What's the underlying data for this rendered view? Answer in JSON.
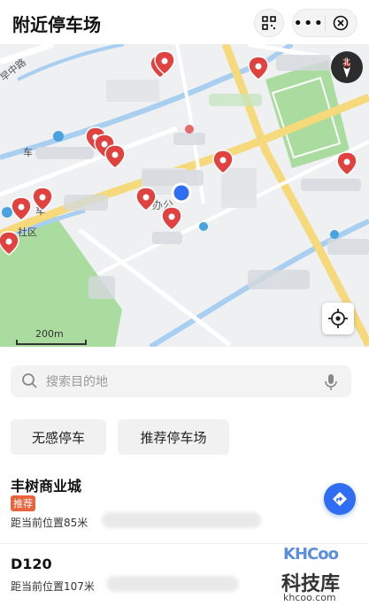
{
  "header": {
    "title": "附近停车场"
  },
  "map": {
    "road_label": "早中路",
    "place_labels": [
      "车",
      "车",
      "社区",
      "办公"
    ],
    "scale": "200m",
    "compass": "北"
  },
  "search": {
    "placeholder": "搜索目的地"
  },
  "filters": [
    {
      "label": "无感停车"
    },
    {
      "label": "推荐停车场"
    }
  ],
  "parking_list": [
    {
      "name": "丰树商业城",
      "badge": "推荐",
      "distance": "距当前位置85米"
    },
    {
      "name": "D120",
      "distance": "距当前位置107米"
    }
  ],
  "watermark": {
    "logo": "KHCoo",
    "cn": "科技库",
    "url": "khcoo.com"
  },
  "colors": {
    "accent": "#2f6df2",
    "pin": "#e0433f",
    "badge": "#e9633d"
  }
}
